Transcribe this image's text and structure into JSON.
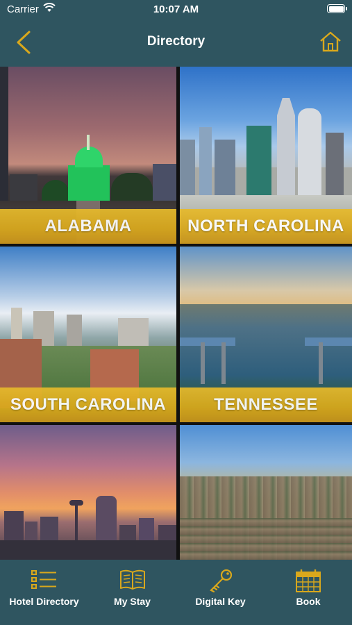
{
  "status_bar": {
    "carrier": "Carrier",
    "time": "10:07 AM"
  },
  "header": {
    "title": "Directory",
    "back_icon": "chevron-left-icon",
    "home_icon": "home-icon",
    "accent_color": "#d9a81c",
    "background_color": "#2f5560"
  },
  "tiles": [
    {
      "label": "ALABAMA"
    },
    {
      "label": "NORTH CAROLINA"
    },
    {
      "label": "SOUTH CAROLINA"
    },
    {
      "label": "TENNESSEE"
    },
    {
      "label": ""
    },
    {
      "label": ""
    }
  ],
  "tabbar": {
    "items": [
      {
        "label": "Hotel Directory",
        "icon": "list-icon"
      },
      {
        "label": "My Stay",
        "icon": "book-icon"
      },
      {
        "label": "Digital Key",
        "icon": "key-icon"
      },
      {
        "label": "Book",
        "icon": "calendar-icon"
      }
    ]
  }
}
